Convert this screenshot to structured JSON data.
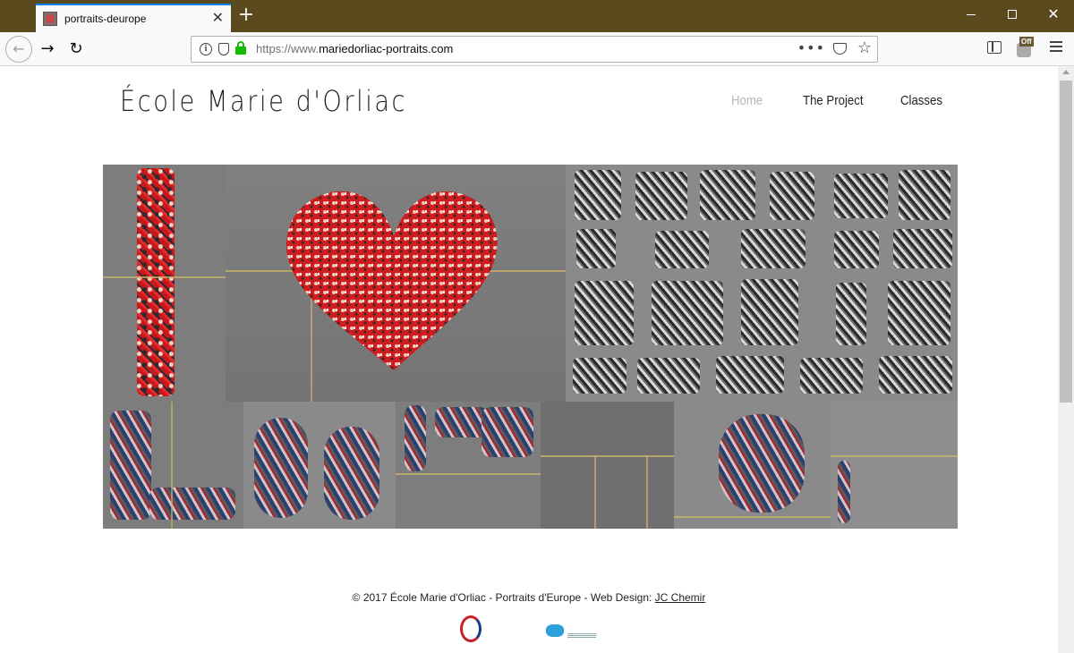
{
  "browser": {
    "tab_title": "portraits-deurope",
    "url_prefix": "https://www.",
    "url_domain": "mariedorliac-portraits.com",
    "extension_badge": "Off"
  },
  "site": {
    "title": "École Marie d'Orliac",
    "nav": [
      {
        "label": "Home",
        "active": true
      },
      {
        "label": "The Project",
        "active": false
      },
      {
        "label": "Classes",
        "active": false
      }
    ]
  },
  "footer": {
    "text": "© 2017 École Marie d'Orliac - Portraits d'Europe - Web Design: ",
    "credit_link": "JC Chemir",
    "logo_lycee": "LYCÉE FRANÇAIS CHARLES DE GAULLE DE LONDRES",
    "logo_aefe": "aefe"
  },
  "colors": {
    "chrome": "#5a4a1e",
    "accent_tab": "#0a84ff",
    "lock_green": "#12bc00",
    "nav_active": "#b8b8b8"
  }
}
